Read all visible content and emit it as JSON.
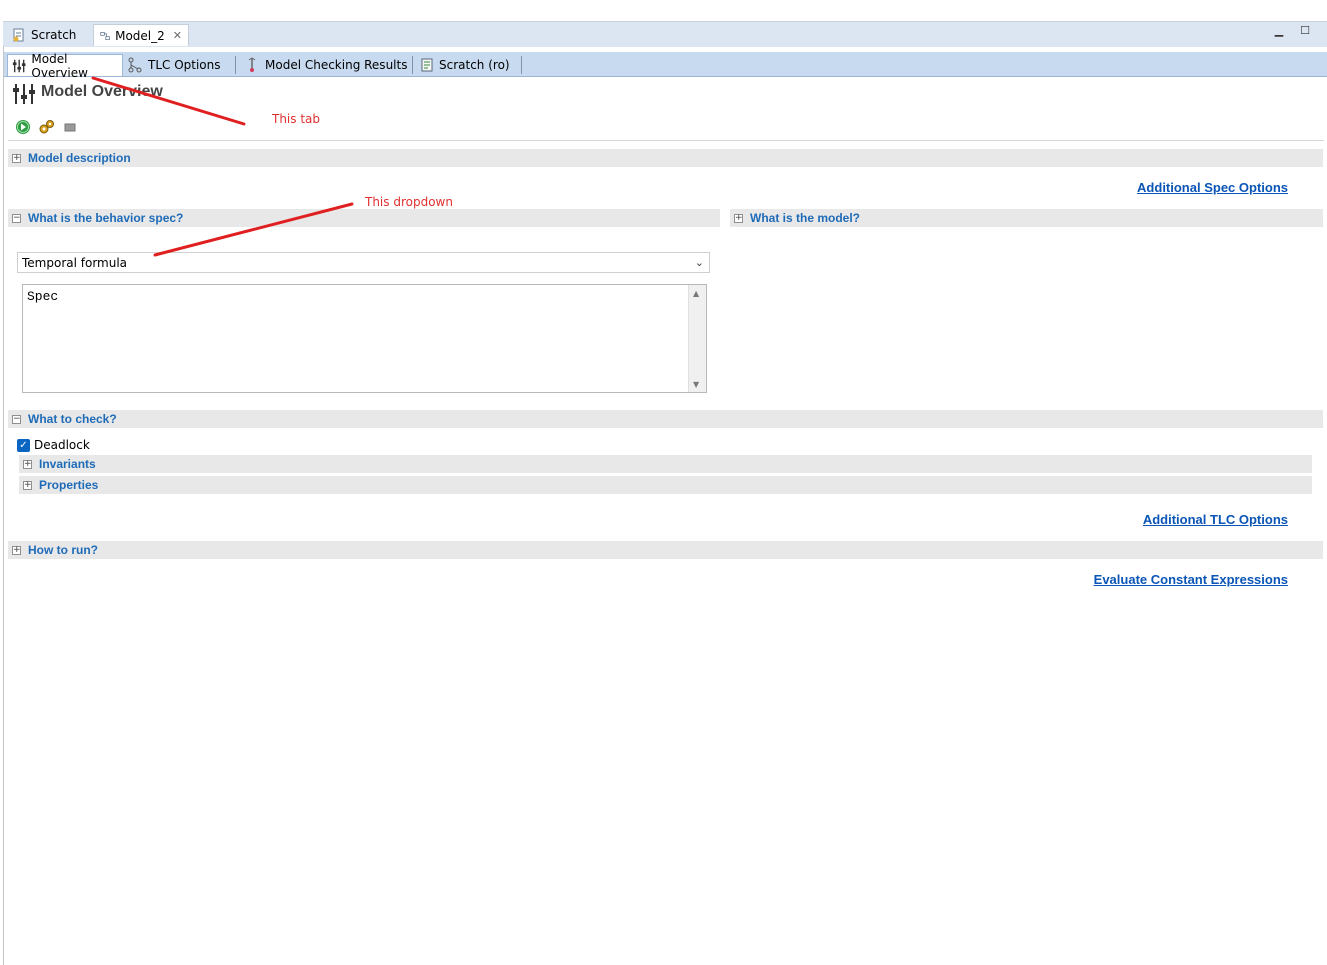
{
  "editor_tabs": [
    {
      "label": "Scratch",
      "icon": "spec-file-icon"
    },
    {
      "label": "Model_2",
      "icon": "model-icon",
      "closable": true
    }
  ],
  "page_tabs": [
    {
      "label": "Model Overview",
      "icon": "sliders-icon",
      "active": true
    },
    {
      "label": "TLC Options",
      "icon": "tree-icon"
    },
    {
      "label": "Model Checking Results",
      "icon": "results-icon"
    },
    {
      "label": "Scratch (ro)",
      "icon": "readonly-spec-icon"
    }
  ],
  "page_title": "Model Overview",
  "toolbar": [
    "run-icon",
    "gears-icon",
    "stop-icon"
  ],
  "sections": {
    "model_description": "Model description",
    "behavior_spec": "What is the behavior spec?",
    "what_is_model": "What is the model?",
    "what_to_check": "What to check?",
    "invariants": "Invariants",
    "properties": "Properties",
    "how_to_run": "How to run?"
  },
  "links": {
    "additional_spec": "Additional Spec Options",
    "additional_tlc": "Additional TLC Options",
    "evaluate_constants": "Evaluate Constant Expressions"
  },
  "behavior": {
    "dropdown_value": "Temporal formula",
    "formula_text": "Spec"
  },
  "checks": {
    "deadlock_label": "Deadlock",
    "deadlock_checked": true
  },
  "annotations": {
    "tab_note": "This tab",
    "dropdown_note": "This dropdown"
  },
  "colors": {
    "section_title": "#1e6bb8",
    "link": "#0a55b5",
    "annotation": "#e03030"
  }
}
